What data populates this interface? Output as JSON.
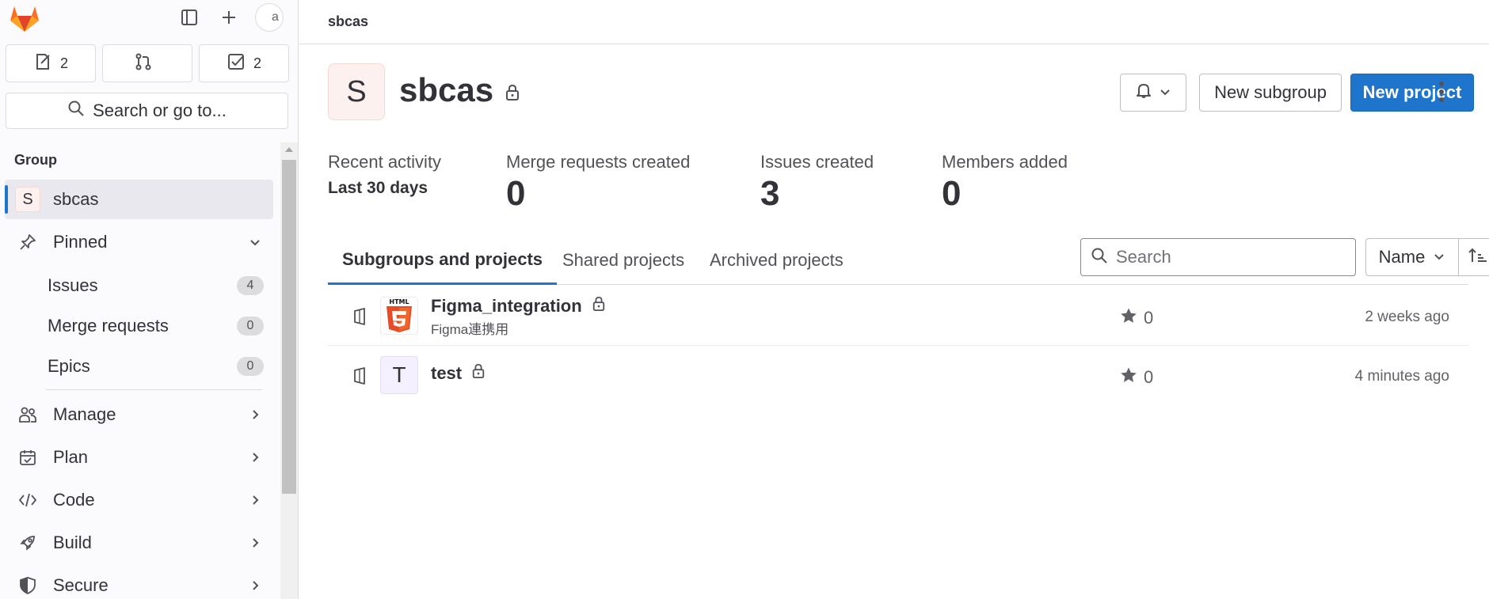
{
  "topbar": {
    "avatar_alt": "a"
  },
  "counts": [
    {
      "icon": "issues-icon",
      "value": "2"
    },
    {
      "icon": "merge-request-icon",
      "value": ""
    },
    {
      "icon": "todo-icon",
      "value": "2"
    }
  ],
  "search_button_label": "Search or go to...",
  "sidebar": {
    "section_label": "Group",
    "group": {
      "avatar_letter": "S",
      "label": "sbcas"
    },
    "pinned": {
      "label": "Pinned",
      "items": [
        {
          "label": "Issues",
          "count": "4"
        },
        {
          "label": "Merge requests",
          "count": "0"
        },
        {
          "label": "Epics",
          "count": "0"
        }
      ]
    },
    "items": [
      {
        "label": "Manage",
        "icon": "users-icon"
      },
      {
        "label": "Plan",
        "icon": "calendar-icon"
      },
      {
        "label": "Code",
        "icon": "code-icon"
      },
      {
        "label": "Build",
        "icon": "rocket-icon"
      },
      {
        "label": "Secure",
        "icon": "shield-icon"
      }
    ]
  },
  "breadcrumb": "sbcas",
  "group": {
    "avatar_letter": "S",
    "name": "sbcas"
  },
  "actions": {
    "new_subgroup": "New subgroup",
    "new_project": "New project"
  },
  "stats": {
    "recent_label": "Recent activity",
    "period": "Last 30 days",
    "items": [
      {
        "label": "Merge requests created",
        "value": "0"
      },
      {
        "label": "Issues created",
        "value": "3"
      },
      {
        "label": "Members added",
        "value": "0"
      }
    ]
  },
  "tabs": [
    {
      "label": "Subgroups and projects",
      "active": true
    },
    {
      "label": "Shared projects",
      "active": false
    },
    {
      "label": "Archived projects",
      "active": false
    }
  ],
  "filter": {
    "search_placeholder": "Search",
    "sort_label": "Name"
  },
  "projects": [
    {
      "name": "Figma_integration",
      "description": "Figma連携用",
      "avatar": "html5-logo",
      "stars": "0",
      "updated": "2 weeks ago"
    },
    {
      "name": "test",
      "description": "",
      "avatar_letter": "T",
      "stars": "0",
      "updated": "4 minutes ago"
    }
  ],
  "colors": {
    "accent": "#1f75cb",
    "sidebar_bg": "#fbfafd",
    "group_avatar_bg": "#fcf1ef",
    "test_avatar_bg": "#f4f0ff"
  }
}
